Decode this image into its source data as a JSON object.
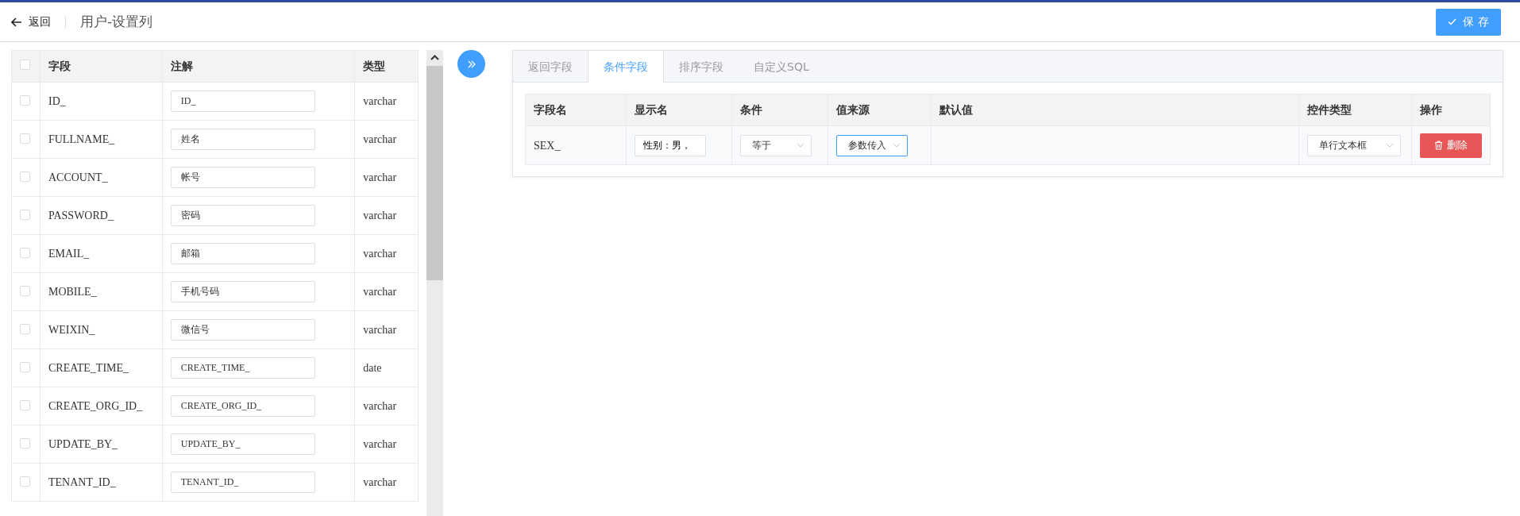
{
  "header": {
    "back_label": "返回",
    "title": "用户-设置列",
    "save_label": "保 存"
  },
  "field_table": {
    "all_checked": false,
    "columns": [
      "字段",
      "注解",
      "类型"
    ],
    "rows": [
      {
        "field": "ID_",
        "comment": "ID_",
        "type": "varchar",
        "checked": false
      },
      {
        "field": "FULLNAME_",
        "comment": "姓名",
        "type": "varchar",
        "checked": false
      },
      {
        "field": "ACCOUNT_",
        "comment": "帐号",
        "type": "varchar",
        "checked": false
      },
      {
        "field": "PASSWORD_",
        "comment": "密码",
        "type": "varchar",
        "checked": false
      },
      {
        "field": "EMAIL_",
        "comment": "邮箱",
        "type": "varchar",
        "checked": false
      },
      {
        "field": "MOBILE_",
        "comment": "手机号码",
        "type": "varchar",
        "checked": false
      },
      {
        "field": "WEIXIN_",
        "comment": "微信号",
        "type": "varchar",
        "checked": false
      },
      {
        "field": "CREATE_TIME_",
        "comment": "CREATE_TIME_",
        "type": "date",
        "checked": false
      },
      {
        "field": "CREATE_ORG_ID_",
        "comment": "CREATE_ORG_ID_",
        "type": "varchar",
        "checked": false
      },
      {
        "field": "UPDATE_BY_",
        "comment": "UPDATE_BY_",
        "type": "varchar",
        "checked": false
      },
      {
        "field": "TENANT_ID_",
        "comment": "TENANT_ID_",
        "type": "varchar",
        "checked": false
      }
    ]
  },
  "tabs": [
    {
      "label": "返回字段",
      "selected": false
    },
    {
      "label": "条件字段",
      "selected": true
    },
    {
      "label": "排序字段",
      "selected": false
    },
    {
      "label": "自定义SQL",
      "selected": false
    }
  ],
  "condition_table": {
    "columns": [
      "字段名",
      "显示名",
      "条件",
      "值来源",
      "默认值",
      "控件类型",
      "操作"
    ],
    "rows": [
      {
        "field_name": "SEX_",
        "display_name": "性别：男，",
        "condition": "等于",
        "value_source": "参数传入",
        "value_source_focused": true,
        "control_type": "单行文本框",
        "delete_label": "删除"
      }
    ]
  }
}
